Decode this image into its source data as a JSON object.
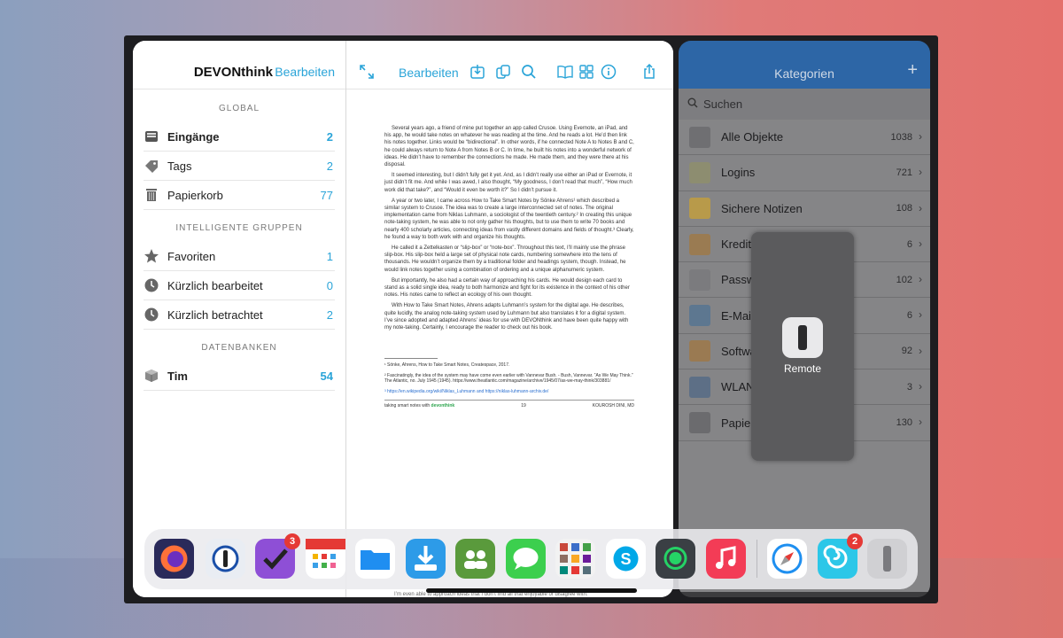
{
  "sidebar": {
    "title": "DEVONthink",
    "edit": "Bearbeiten",
    "sections": {
      "global": "GLOBAL",
      "smart": "INTELLIGENTE GRUPPEN",
      "db": "DATENBANKEN"
    },
    "global_items": [
      {
        "label": "Eingänge",
        "count": "2",
        "icon": "inbox-icon"
      },
      {
        "label": "Tags",
        "count": "2",
        "icon": "tag-icon"
      },
      {
        "label": "Papierkorb",
        "count": "77",
        "icon": "trash-icon"
      }
    ],
    "smart_items": [
      {
        "label": "Favoriten",
        "count": "1",
        "icon": "star-icon"
      },
      {
        "label": "Kürzlich bearbeitet",
        "count": "0",
        "icon": "clock-icon"
      },
      {
        "label": "Kürzlich betrachtet",
        "count": "2",
        "icon": "clock-icon"
      }
    ],
    "db_items": [
      {
        "label": "Tim",
        "count": "54",
        "icon": "database-box-icon"
      }
    ]
  },
  "doc": {
    "edit": "Bearbeiten",
    "paragraphs": [
      "Several years ago, a friend of mine put together an app called Crusoe. Using Evernote, an iPad, and his app, he would take notes on whatever he was reading at the time. And he reads a lot. He’d then link his notes together. Links would be “bidirectional”. In other words, if he connected Note A to Notes B and C, he could always return to Note A from Notes B or C. In time, he built his notes into a wonderful network of ideas. He didn’t have to remember the connections he made. He made them, and they were there at his disposal.",
      "It seemed interesting, but I didn’t fully get it yet. And, as I didn’t really use either an iPad or Evernote, it just didn’t fit me. And while I was awed, I also thought, “My goodness, I don’t read that much”, “How much work did that take?”, and “Would it even be worth it?” So I didn’t pursue it.",
      "A year or two later, I came across How to Take Smart Notes by Sönke Ahrens¹ which described a similar system to Crusoe. The idea was to create a large interconnected set of notes. The original implementation came from Niklas Luhmann, a sociologist of the twentieth century.² In creating this unique note-taking system, he was able to not only gather his thoughts, but to use them to write 70 books and nearly 400 scholarly articles, connecting ideas from vastly different domains and fields of thought.³ Clearly, he found a way to both work with and organize his thoughts.",
      "He called it a Zettelkasten or “slip-box” or “note-box”. Throughout this text, I’ll mainly use the phrase slip-box. His slip-box held a large set of physical note cards, numbering somewhere into the tens of thousands. He wouldn’t organize them by a traditional folder and headings system, though. Instead, he would link notes together using a combination of ordering and a unique alphanumeric system.",
      "But importantly, he also had a certain way of approaching his cards. He would design each card to stand as a solid single idea, ready to both harmonize and fight for its existence in the context of his other notes. His notes came to reflect an ecology of his own thought.",
      "With How to Take Smart Notes, Ahrens adapts Luhmann’s system for the digital age. He describes, quite lucidly, the analog note-taking system used by Luhmann but also translates it for a digital system. I’ve since adopted and adapted Ahrens’ ideas for use with DEVONthink and have been quite happy with my note-taking. Certainly, I encourage the reader to check out his book."
    ],
    "footnote1": "¹ Sönke, Ahrens, How to Take Smart Notes, Createspace, 2017.",
    "footnote2": "² Fascinatingly, the idea of the system may have come even earlier with Vannevar Bush. - Bush, Vannevar. “As We May Think.” The Atlantic, no. July 1945 (1945). https://www.theatlantic.com/magazine/archive/1945/07/as-we-may-think/303881/",
    "footnote3": "³ https://en.wikipedia.org/wiki/Niklas_Luhmann and https://niklas-luhmann-archiv.de/",
    "footer_left": "taking smart notes with",
    "footer_brand": "devonthink",
    "footer_page": "19",
    "footer_right": "KOUROSH DINI, MD",
    "peek_text": "I’m even able to approach ideas that I don’t find all that enjoyable or disagree with."
  },
  "categories": {
    "title": "Kategorien",
    "plus": "+",
    "search_placeholder": "Suchen",
    "items": [
      {
        "label": "Alle Objekte",
        "count": "1038",
        "icon": "all-objects-icon",
        "color": "#6f6f72"
      },
      {
        "label": "Logins",
        "count": "721",
        "icon": "key-login-icon",
        "color": "#8d8d70"
      },
      {
        "label": "Sichere Notizen",
        "count": "108",
        "icon": "notepad-icon",
        "color": "#b89a4a"
      },
      {
        "label": "Kredit",
        "count": "6",
        "icon": "credit-card-icon",
        "color": "#9a7b52"
      },
      {
        "label": "Passw",
        "count": "102",
        "icon": "key-icon",
        "color": "#7b7b7e"
      },
      {
        "label": "E-Mail",
        "count": "6",
        "icon": "envelope-icon",
        "color": "#5d7790"
      },
      {
        "label": "Softwa",
        "count": "92",
        "icon": "app-store-icon",
        "color": "#9a7a52"
      },
      {
        "label": "WLAN",
        "count": "3",
        "icon": "wifi-icon",
        "color": "#5d6f86"
      },
      {
        "label": "Papier",
        "count": "130",
        "icon": "trash-icon",
        "color": "#6b6b6e"
      }
    ]
  },
  "overlay": {
    "label": "Remote"
  },
  "dock": {
    "apps": [
      {
        "name": "firefox-app-icon",
        "color": "#2a2a5a"
      },
      {
        "name": "1password-app-icon",
        "color": "#e9edf3"
      },
      {
        "name": "omnifocus-app-icon",
        "color": "#8e4fd6",
        "badge": "3"
      },
      {
        "name": "fantastical-app-icon",
        "color": "#ffffff"
      },
      {
        "name": "files-app-icon",
        "color": "#ffffff"
      },
      {
        "name": "transloader-app-icon",
        "color": "#2d9be8"
      },
      {
        "name": "contacts-app-icon",
        "color": "#5a9a3c"
      },
      {
        "name": "messages-app-icon",
        "color": "#3ccf4e"
      },
      {
        "name": "folder-grid-app-icon",
        "color": "#f2f2f2"
      },
      {
        "name": "skype-app-icon",
        "color": "#ffffff"
      },
      {
        "name": "whatsapp-app-icon",
        "color": "#3a3f44"
      },
      {
        "name": "music-app-icon",
        "color": "#f33c56"
      },
      {
        "name": "safari-app-icon",
        "color": "#ffffff"
      },
      {
        "name": "shell-app-icon",
        "color": "#2cc7e8",
        "badge": "2"
      },
      {
        "name": "remote-app-icon",
        "color": "#d0d0d3"
      }
    ]
  }
}
